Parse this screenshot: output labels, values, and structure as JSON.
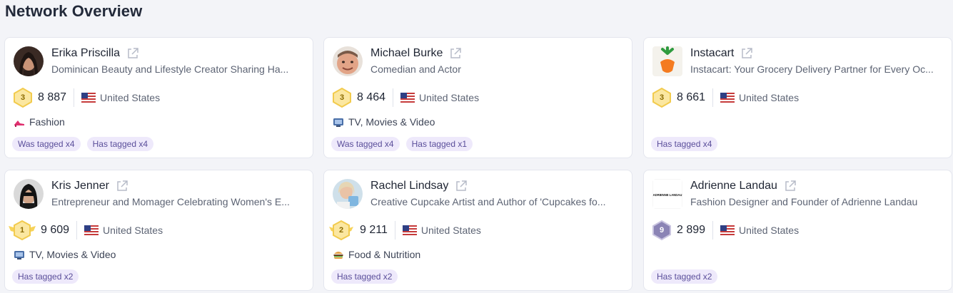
{
  "page": {
    "title": "Network Overview"
  },
  "cards": [
    {
      "name": "Erika Priscilla",
      "description": "Dominican Beauty and Lifestyle Creator Sharing Ha...",
      "rank": "3",
      "count": "8 887",
      "country": "United States",
      "category": "Fashion",
      "tags": [
        "Was tagged x4",
        "Has tagged x4"
      ]
    },
    {
      "name": "Michael Burke",
      "description": "Comedian and Actor",
      "rank": "3",
      "count": "8 464",
      "country": "United States",
      "category": "TV, Movies & Video",
      "tags": [
        "Was tagged x4",
        "Has tagged x1"
      ]
    },
    {
      "name": "Instacart",
      "description": "Instacart: Your Grocery Delivery Partner for Every Oc...",
      "rank": "3",
      "count": "8 661",
      "country": "United States",
      "category": "",
      "tags": [
        "Has tagged x4"
      ]
    },
    {
      "name": "Kris Jenner",
      "description": "Entrepreneur and Momager Celebrating Women's E...",
      "rank": "1",
      "count": "9 609",
      "country": "United States",
      "category": "TV, Movies & Video",
      "tags": [
        "Has tagged x2"
      ]
    },
    {
      "name": "Rachel Lindsay",
      "description": "Creative Cupcake Artist and Author of 'Cupcakes fo...",
      "rank": "2",
      "count": "9 211",
      "country": "United States",
      "category": "Food & Nutrition",
      "tags": [
        "Has tagged x2"
      ]
    },
    {
      "name": "Adrienne Landau",
      "description": "Fashion Designer and Founder of Adrienne Landau",
      "rank": "9",
      "count": "2 899",
      "country": "United States",
      "category": "",
      "tags": [
        "Has tagged x2"
      ],
      "logo_text": "ADRIENNE LANDAU"
    }
  ],
  "colors": {
    "gold_badge": "#f7d35a",
    "purple_badge": "#7c75a8",
    "tag_bg": "#eee9fb",
    "tag_text": "#5a4e9a"
  }
}
